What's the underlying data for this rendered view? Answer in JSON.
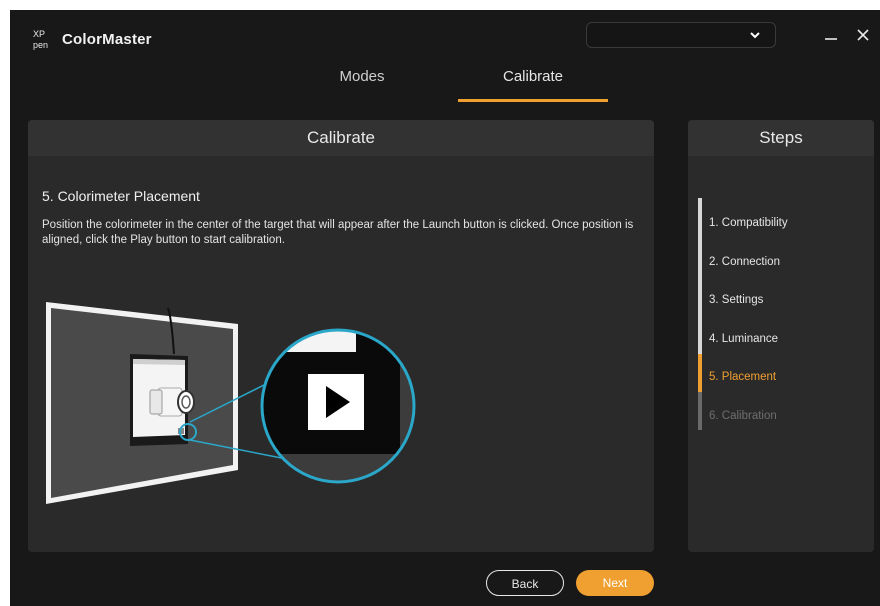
{
  "app": {
    "logo_text": "XP pen",
    "title": "ColorMaster"
  },
  "device_select": {
    "value": ""
  },
  "tabs": [
    {
      "label": "Modes"
    },
    {
      "label": "Calibrate"
    }
  ],
  "main": {
    "header": "Calibrate",
    "section_title": "5. Colorimeter Placement",
    "description": "Position the colorimeter in the center of the target that will appear after the Launch button is clicked. Once position is aligned, click the Play button to start calibration."
  },
  "steps": {
    "header": "Steps",
    "items": [
      {
        "label": "1. Compatibility",
        "state": "done"
      },
      {
        "label": "2. Connection",
        "state": "done"
      },
      {
        "label": "3. Settings",
        "state": "done"
      },
      {
        "label": "4. Luminance",
        "state": "done"
      },
      {
        "label": "5. Placement",
        "state": "active"
      },
      {
        "label": "6. Calibration",
        "state": "pending"
      }
    ]
  },
  "buttons": {
    "back": "Back",
    "next": "Next"
  },
  "colors": {
    "accent": "#f0a030",
    "window_bg": "#181818",
    "panel_bg": "#2a2a2a",
    "callout": "#2aa7c9"
  },
  "icons": {
    "select": "chevron-down-icon",
    "minimize": "minimize-icon",
    "close": "close-icon",
    "play": "play-icon"
  }
}
